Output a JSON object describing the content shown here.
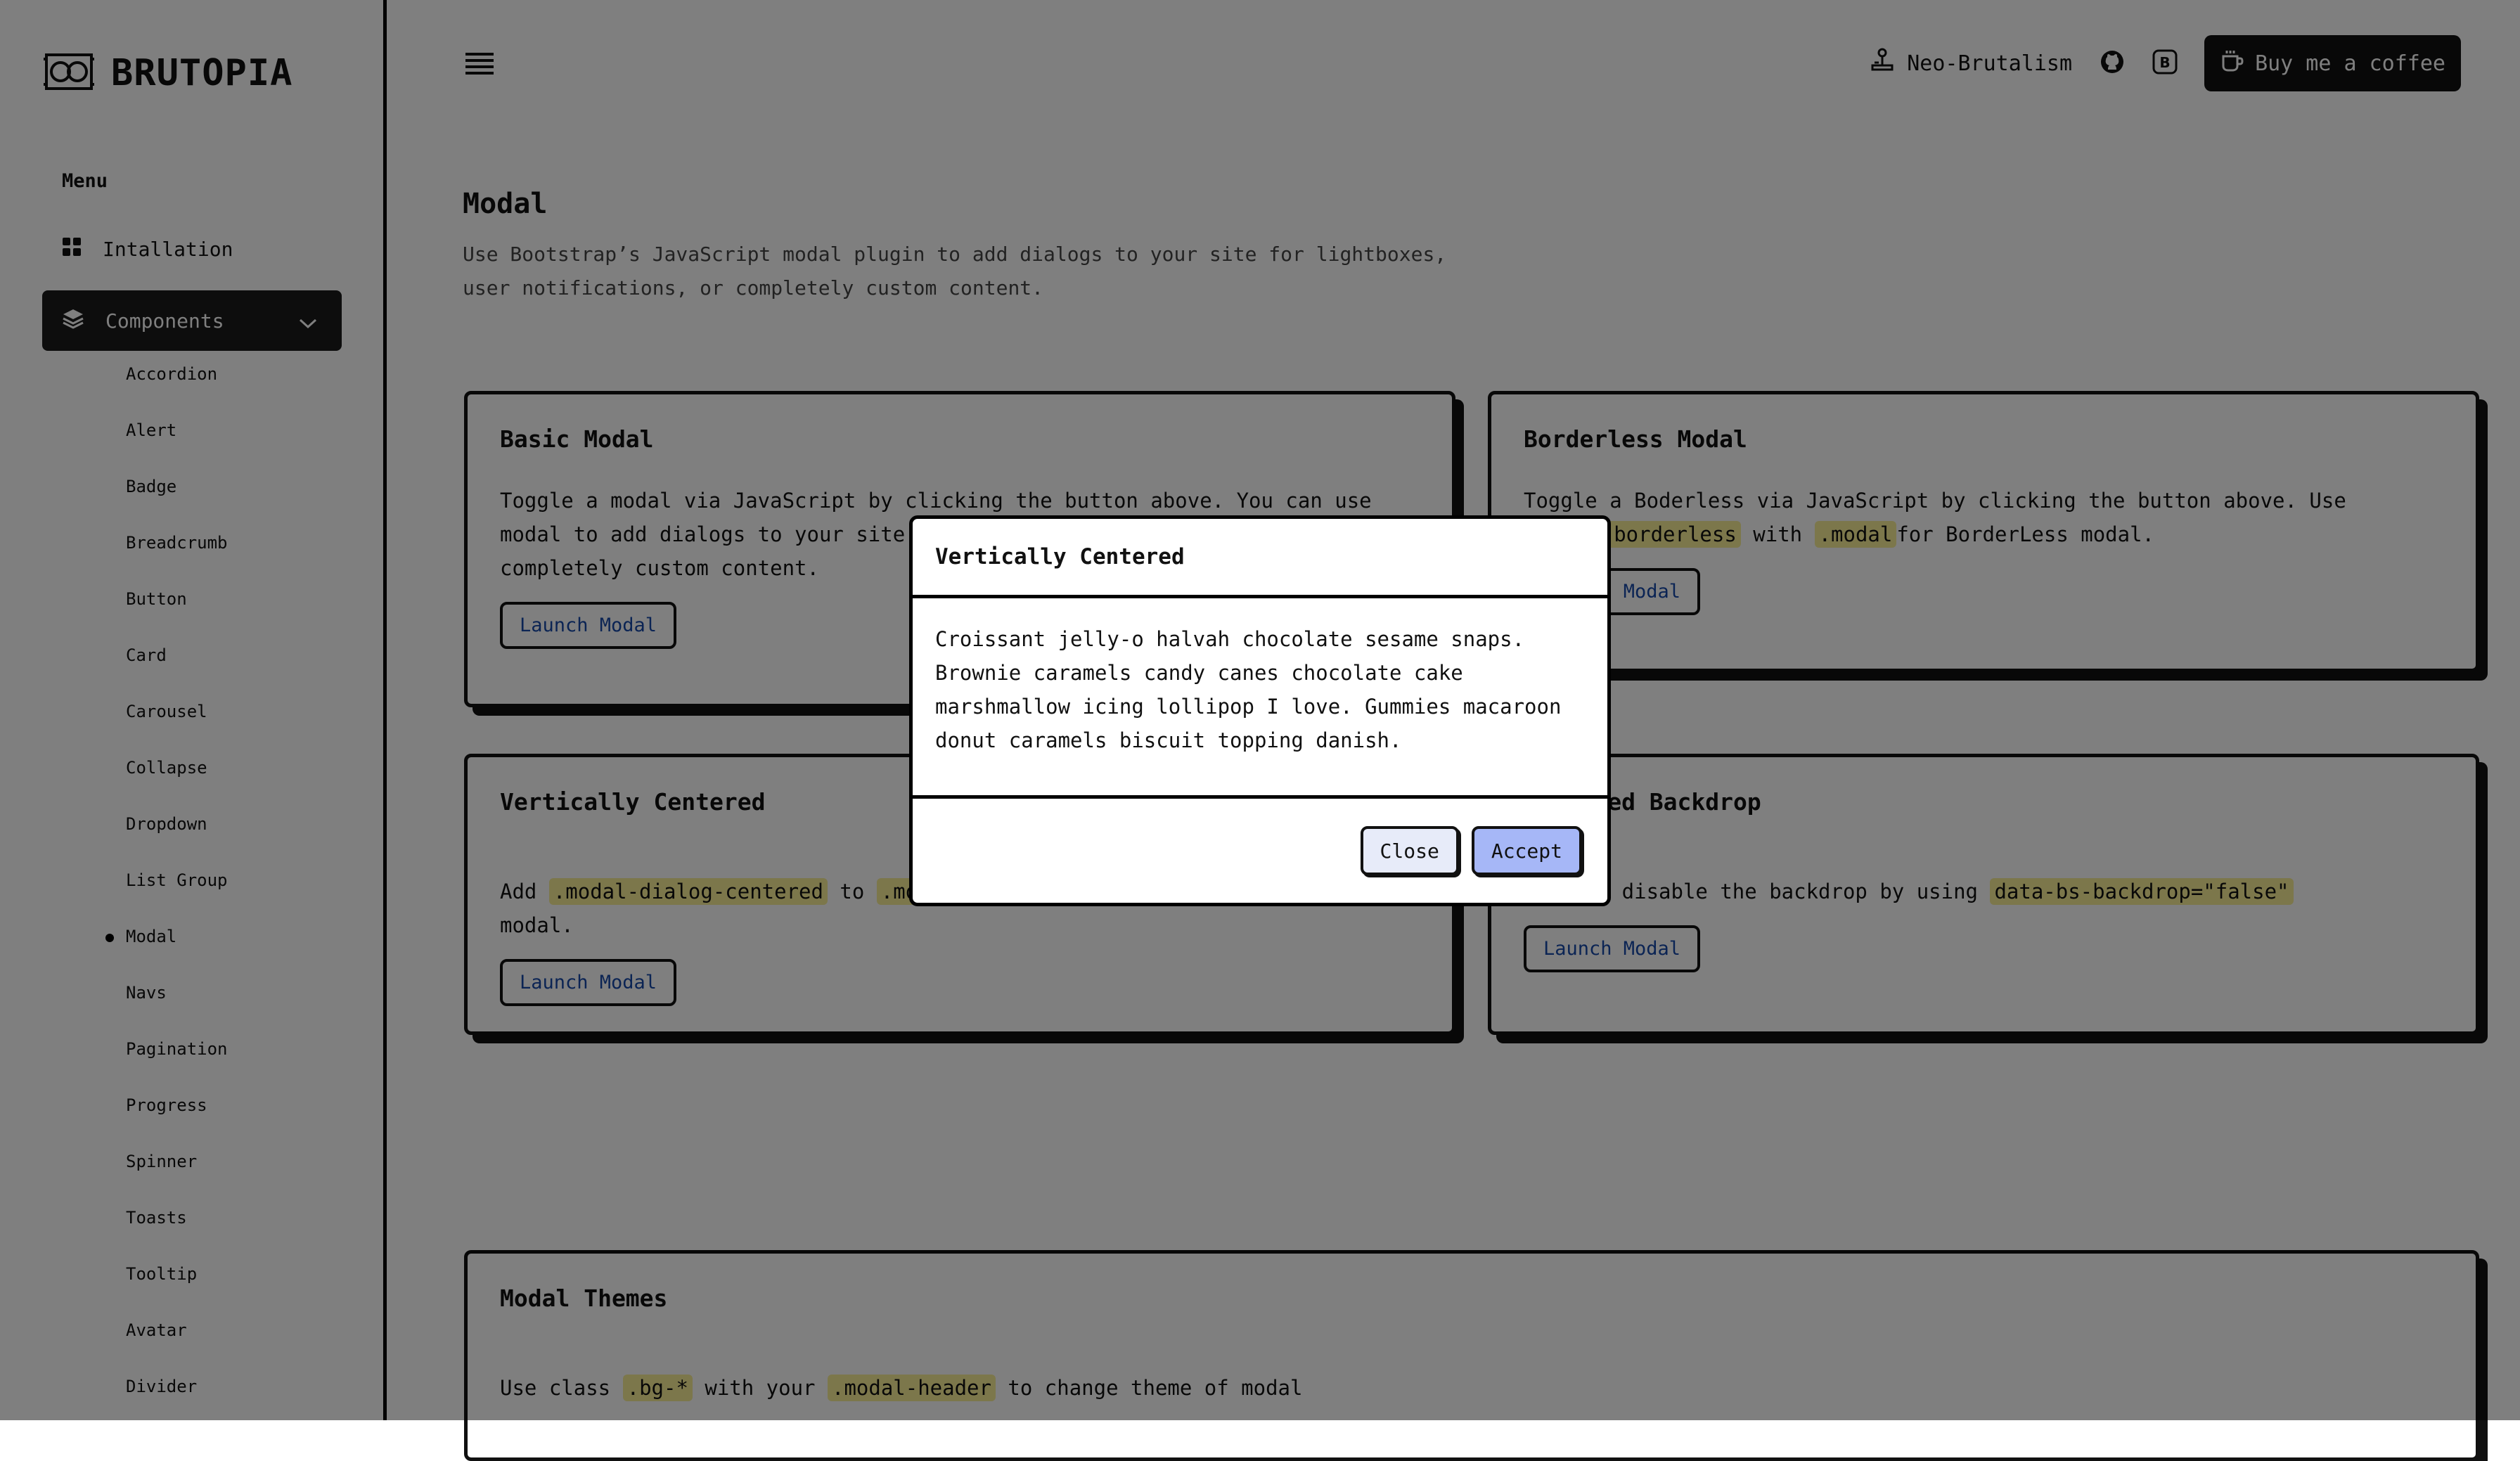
{
  "brand": {
    "name": "BRUTOPIA",
    "logo_icon": "glasses-logo-icon"
  },
  "sidebar": {
    "menu_label": "Menu",
    "installation": {
      "label": "Intallation",
      "icon": "grid-icon"
    },
    "components": {
      "label": "Components",
      "icon": "layers-icon"
    },
    "sub_items": [
      {
        "label": "Accordion"
      },
      {
        "label": "Alert"
      },
      {
        "label": "Badge"
      },
      {
        "label": "Breadcrumb"
      },
      {
        "label": "Button"
      },
      {
        "label": "Card"
      },
      {
        "label": "Carousel"
      },
      {
        "label": "Collapse"
      },
      {
        "label": "Dropdown"
      },
      {
        "label": "List Group"
      },
      {
        "label": "Modal",
        "active": true
      },
      {
        "label": "Navs"
      },
      {
        "label": "Pagination"
      },
      {
        "label": "Progress"
      },
      {
        "label": "Spinner"
      },
      {
        "label": "Toasts"
      },
      {
        "label": "Tooltip"
      },
      {
        "label": "Avatar"
      },
      {
        "label": "Divider"
      }
    ]
  },
  "topbar": {
    "theme_label": "Neo-Brutalism",
    "coffee_label": "Buy me a coffee"
  },
  "page": {
    "title": "Modal",
    "description": "Use Bootstrap’s JavaScript modal plugin to add dialogs to your site for lightboxes, user notifications, or completely custom content."
  },
  "cards": {
    "basic": {
      "title": "Basic Modal",
      "text": "Toggle a modal via JavaScript by clicking the button above. You can use modal to add dialogs to your site for lightboxes, user notifications, or completely custom content.",
      "button": "Launch Modal"
    },
    "borderless": {
      "title": "Borderless Modal",
      "text_1": "Toggle a Boderless via JavaScript by clicking the button above. Use ",
      "code_1": ".modal-borderless",
      "text_2": " with ",
      "code_2": ".modal",
      "text_3": "for BorderLess modal.",
      "button": "Launch Modal"
    },
    "centered": {
      "title": "Vertically Centered",
      "text_1": "Add ",
      "code_1": ".modal-dialog-centered",
      "text_2": " to ",
      "code_2": ".modal-dialog",
      "text_3": " to vertically center the modal.",
      "button": "Launch Modal"
    },
    "backdrop": {
      "title": "Disabled Backdrop",
      "text_1": "You can disable the backdrop by using ",
      "code_1": "data-bs-backdrop=\"false\"",
      "button": "Launch Modal"
    },
    "themes": {
      "title": "Modal Themes",
      "text_1": "Use class ",
      "code_1": ".bg-*",
      "text_2": " with your ",
      "code_2": ".modal-header",
      "text_3": " to change theme of modal"
    }
  },
  "modal": {
    "title": "Vertically Centered",
    "body": "Croissant jelly-o halvah chocolate sesame snaps. Brownie caramels candy canes chocolate cake marshmallow icing lollipop I love. Gummies macaroon donut caramels biscuit topping danish.",
    "close_label": "Close",
    "accept_label": "Accept"
  },
  "colors": {
    "code_highlight": "#f8ee96",
    "accept_button": "#a6b7f7",
    "close_button": "#e7ebf9",
    "link": "#1749a8",
    "backdrop": "rgba(0,0,0,0.5)"
  }
}
